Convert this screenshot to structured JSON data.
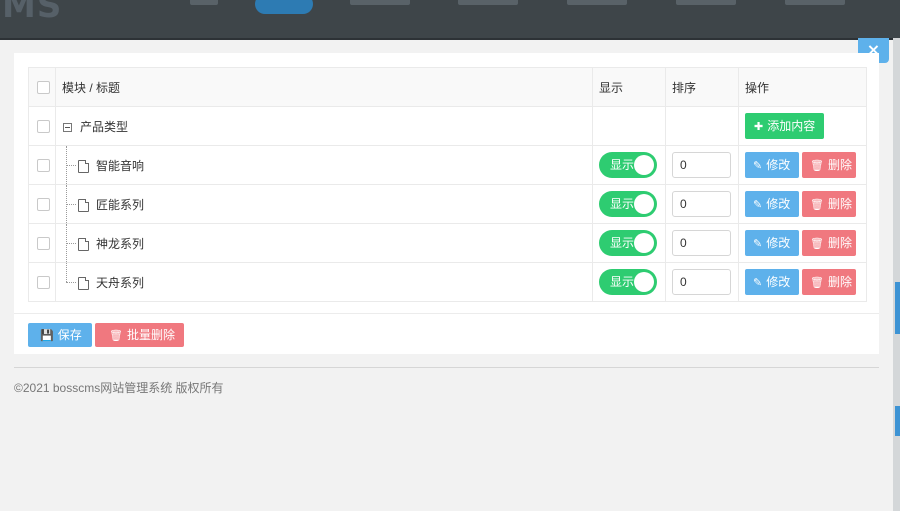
{
  "colors": {
    "accent_blue": "#5eb1eb",
    "success_green": "#2ecc71",
    "danger_red": "#f0787f"
  },
  "modal": {
    "close_label": "×"
  },
  "table": {
    "headers": {
      "title": "模块 / 标题",
      "display": "显示",
      "order": "排序",
      "actions": "操作"
    },
    "category": {
      "name": "产品类型",
      "add_label": "添加内容"
    },
    "rows": [
      {
        "title": "智能音响",
        "display_label": "显示",
        "order": "0",
        "edit_label": "修改",
        "delete_label": "删除"
      },
      {
        "title": "匠能系列",
        "display_label": "显示",
        "order": "0",
        "edit_label": "修改",
        "delete_label": "删除"
      },
      {
        "title": "神龙系列",
        "display_label": "显示",
        "order": "0",
        "edit_label": "修改",
        "delete_label": "删除"
      },
      {
        "title": "天舟系列",
        "display_label": "显示",
        "order": "0",
        "edit_label": "修改",
        "delete_label": "删除"
      }
    ]
  },
  "actions": {
    "save_label": "保存",
    "batch_delete_label": "批量删除"
  },
  "footer": {
    "copyright": "©2021 bosscms网站管理系统 版权所有"
  },
  "background": {
    "logo_text": "MS"
  }
}
